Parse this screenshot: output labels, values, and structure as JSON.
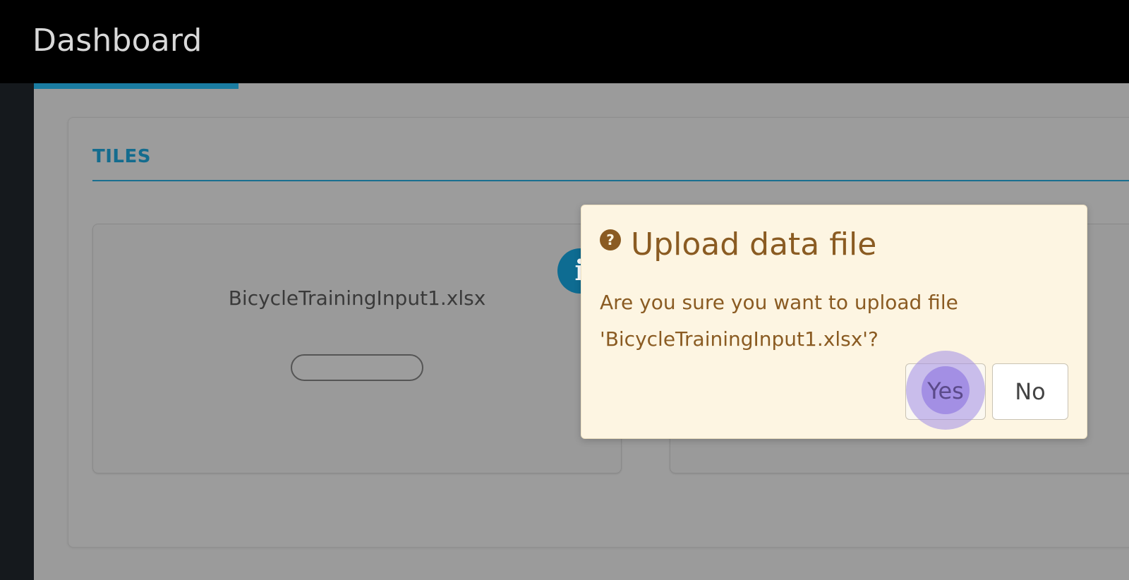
{
  "header": {
    "title": "Dashboard"
  },
  "tiles_section": {
    "title": "TILES",
    "tiles": [
      {
        "filename": "BicycleTrainingInput1.xlsx"
      }
    ]
  },
  "info_badge": {
    "glyph": "i"
  },
  "dialog": {
    "icon_glyph": "?",
    "title": "Upload data file",
    "message": "Are you sure you want to upload file 'BicycleTrainingInput1.xlsx'?",
    "yes_label": "Yes",
    "no_label": "No"
  },
  "colors": {
    "topbar": "#000000",
    "accent": "#1a7ca1",
    "dialog_background": "#fdf5e2",
    "dialog_text": "#8a5b22"
  }
}
